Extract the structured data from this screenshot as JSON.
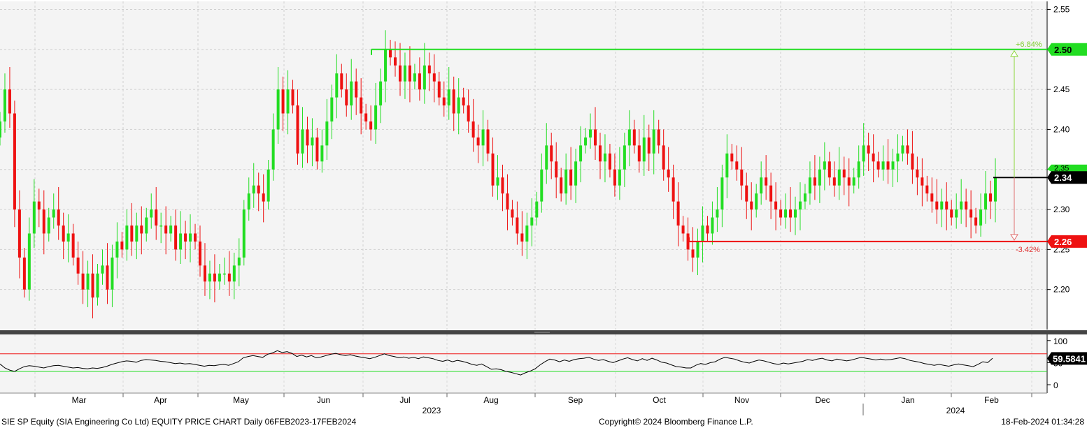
{
  "chart_data": [
    {
      "type": "candlestick",
      "title": "",
      "y_ticks": [
        2.2,
        2.25,
        2.3,
        2.35,
        2.4,
        2.45,
        2.5,
        2.55
      ],
      "ylim": [
        2.15,
        2.56
      ],
      "x_month_labels": [
        "Mar",
        "Apr",
        "May",
        "Jun",
        "Jul",
        "Aug",
        "Sep",
        "Oct",
        "Nov",
        "Dec",
        "Jan",
        "Feb"
      ],
      "x_year_labels": [
        "2023",
        "2024"
      ],
      "last_price": "2.34",
      "resistance": {
        "value": "2.50",
        "pct_label": "+6.84%"
      },
      "support": {
        "value": "2.26",
        "pct_label": "-3.42%"
      },
      "legend_hint": "2.35",
      "up_color": "#22dd22",
      "down_color": "#ee1111",
      "closes": [
        2.41,
        2.45,
        2.42,
        2.3,
        2.24,
        2.2,
        2.27,
        2.31,
        2.3,
        2.27,
        2.29,
        2.3,
        2.28,
        2.26,
        2.27,
        2.24,
        2.22,
        2.2,
        2.22,
        2.19,
        2.22,
        2.23,
        2.2,
        2.24,
        2.26,
        2.25,
        2.28,
        2.26,
        2.28,
        2.27,
        2.29,
        2.3,
        2.28,
        2.28,
        2.27,
        2.28,
        2.25,
        2.27,
        2.26,
        2.27,
        2.26,
        2.23,
        2.21,
        2.22,
        2.21,
        2.22,
        2.22,
        2.21,
        2.23,
        2.24,
        2.3,
        2.32,
        2.33,
        2.32,
        2.31,
        2.35,
        2.4,
        2.45,
        2.42,
        2.45,
        2.43,
        2.37,
        2.4,
        2.38,
        2.39,
        2.36,
        2.38,
        2.41,
        2.44,
        2.47,
        2.45,
        2.43,
        2.46,
        2.44,
        2.42,
        2.41,
        2.4,
        2.43,
        2.46,
        2.5,
        2.49,
        2.48,
        2.46,
        2.48,
        2.46,
        2.47,
        2.45,
        2.48,
        2.47,
        2.46,
        2.44,
        2.43,
        2.45,
        2.42,
        2.44,
        2.43,
        2.41,
        2.39,
        2.38,
        2.4,
        2.37,
        2.33,
        2.34,
        2.32,
        2.3,
        2.29,
        2.27,
        2.26,
        2.28,
        2.29,
        2.31,
        2.35,
        2.38,
        2.36,
        2.34,
        2.32,
        2.35,
        2.33,
        2.36,
        2.38,
        2.39,
        2.4,
        2.38,
        2.36,
        2.37,
        2.35,
        2.33,
        2.35,
        2.38,
        2.4,
        2.38,
        2.36,
        2.39,
        2.37,
        2.4,
        2.38,
        2.35,
        2.34,
        2.31,
        2.28,
        2.27,
        2.25,
        2.24,
        2.26,
        2.28,
        2.27,
        2.29,
        2.3,
        2.34,
        2.37,
        2.36,
        2.35,
        2.33,
        2.31,
        2.3,
        2.32,
        2.34,
        2.33,
        2.31,
        2.3,
        2.29,
        2.3,
        2.29,
        2.3,
        2.31,
        2.32,
        2.34,
        2.33,
        2.35,
        2.36,
        2.34,
        2.33,
        2.35,
        2.34,
        2.33,
        2.34,
        2.36,
        2.38,
        2.37,
        2.36,
        2.35,
        2.36,
        2.35,
        2.36,
        2.37,
        2.38,
        2.37,
        2.35,
        2.34,
        2.33,
        2.32,
        2.31,
        2.3,
        2.31,
        2.3,
        2.29,
        2.3,
        2.31,
        2.3,
        2.29,
        2.28,
        2.3,
        2.32,
        2.31,
        2.34
      ],
      "rsi": {
        "y_ticks": [
          0,
          50,
          100
        ],
        "overbought": 70,
        "oversold": 30,
        "last_value": "59.5841",
        "values": [
          47,
          38,
          33,
          30,
          36,
          41,
          43,
          42,
          40,
          38,
          41,
          43,
          44,
          42,
          40,
          38,
          39,
          37,
          36,
          38,
          37,
          39,
          42,
          46,
          49,
          52,
          54,
          53,
          51,
          55,
          57,
          56,
          55,
          53,
          52,
          50,
          48,
          49,
          47,
          48,
          46,
          44,
          42,
          44,
          43,
          45,
          46,
          44,
          48,
          52,
          61,
          64,
          66,
          64,
          62,
          69,
          72,
          77,
          73,
          75,
          71,
          64,
          67,
          63,
          66,
          61,
          63,
          66,
          69,
          71,
          68,
          66,
          68,
          65,
          63,
          61,
          59,
          62,
          66,
          70,
          66,
          64,
          61,
          63,
          60,
          62,
          59,
          63,
          61,
          59,
          55,
          53,
          56,
          52,
          55,
          53,
          50,
          46,
          44,
          47,
          41,
          35,
          36,
          34,
          30,
          28,
          25,
          22,
          27,
          31,
          36,
          45,
          52,
          58,
          56,
          52,
          56,
          53,
          57,
          59,
          60,
          62,
          58,
          55,
          57,
          53,
          50,
          54,
          58,
          61,
          57,
          54,
          59,
          55,
          60,
          56,
          51,
          49,
          45,
          41,
          40,
          38,
          38,
          44,
          48,
          46,
          50,
          52,
          58,
          62,
          60,
          58,
          54,
          51,
          49,
          53,
          56,
          54,
          51,
          48,
          46,
          49,
          47,
          49,
          51,
          53,
          57,
          55,
          58,
          60,
          56,
          54,
          58,
          56,
          54,
          56,
          59,
          62,
          60,
          58,
          56,
          58,
          56,
          57,
          59,
          61,
          59,
          55,
          53,
          51,
          48,
          46,
          44,
          46,
          44,
          42,
          45,
          47,
          45,
          43,
          41,
          46,
          52,
          50,
          60
        ]
      }
    }
  ],
  "footer": {
    "left": "SIE SP Equity (SIA Engineering Co Ltd) EQUITY PRICE CHART  Daily 06FEB2023-17FEB2024",
    "center": "Copyright© 2024 Bloomberg Finance L.P.",
    "right": "18-Feb-2024 01:34:28"
  }
}
